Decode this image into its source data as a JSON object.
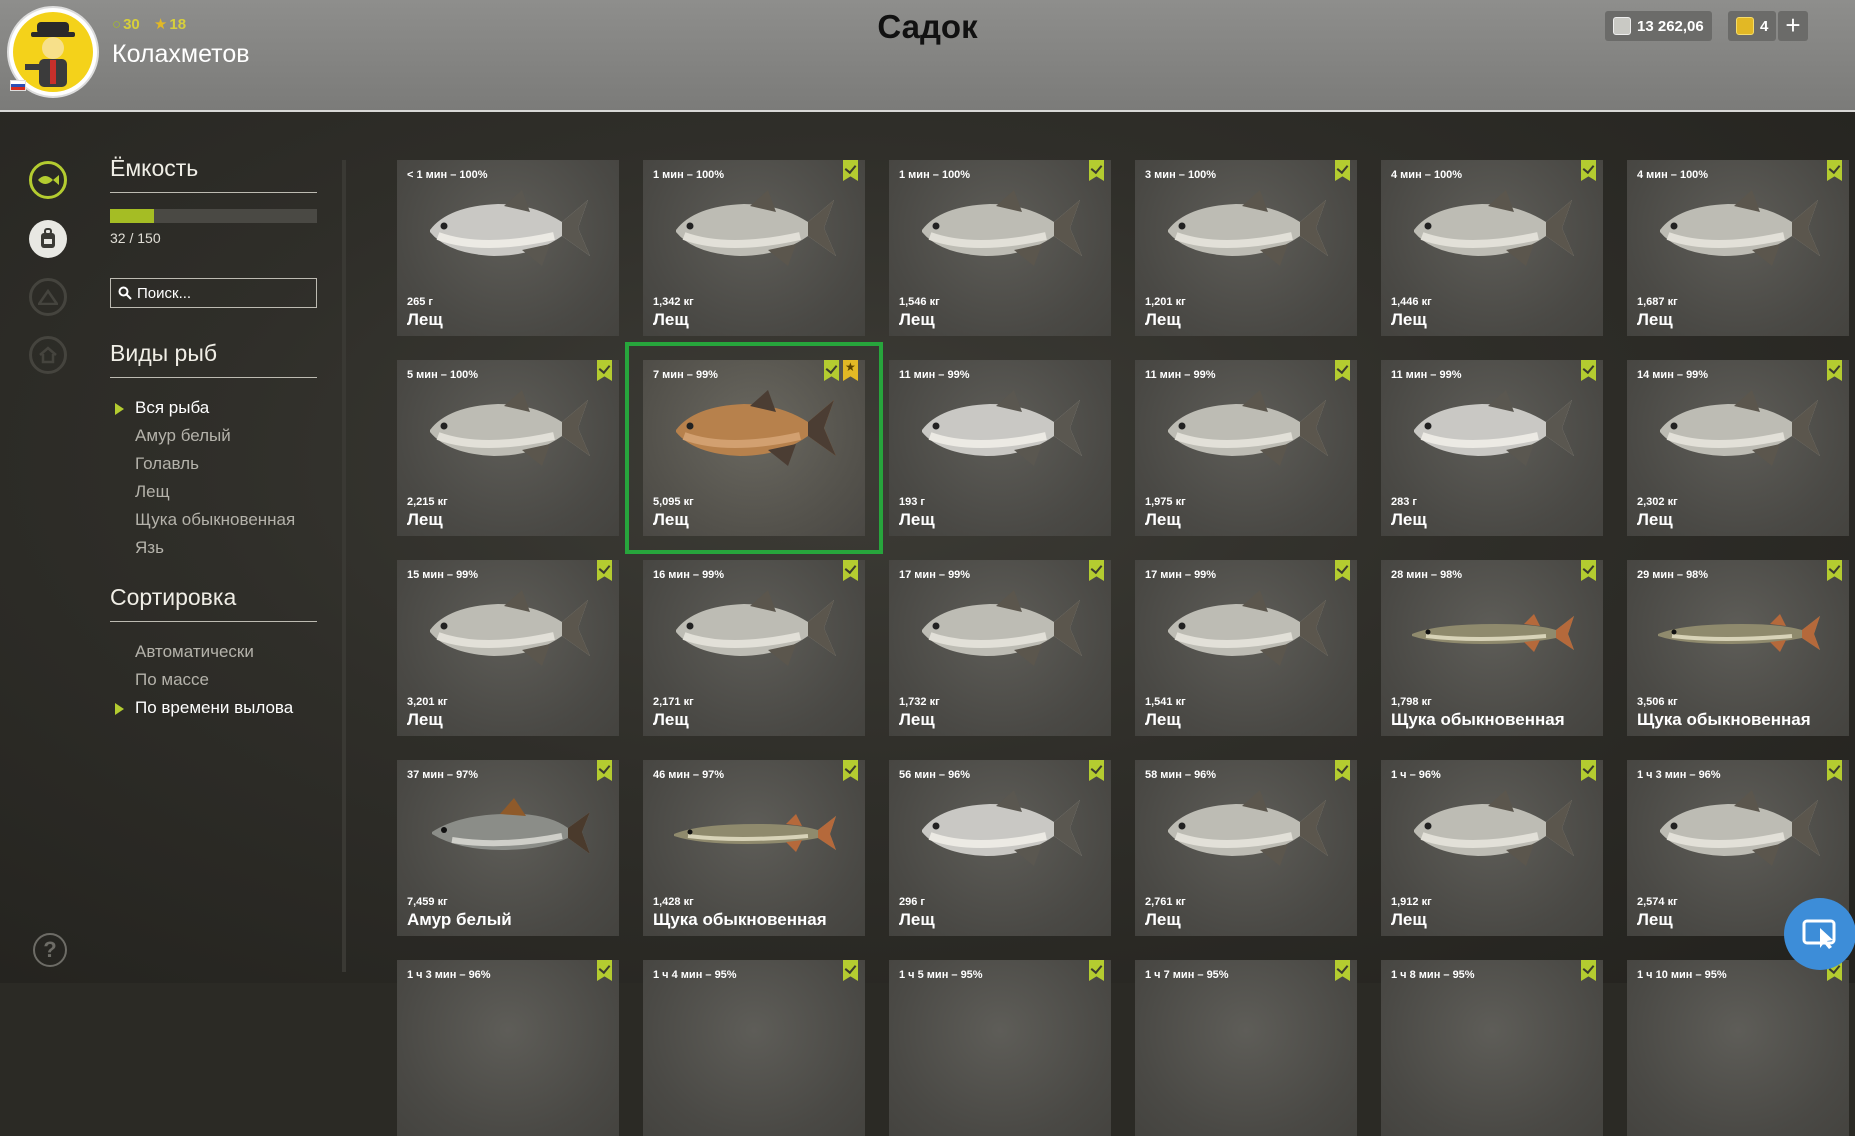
{
  "header": {
    "title": "Садок",
    "player_name": "Колахметов",
    "level": "30",
    "rank": "18",
    "silver": "13 262,06",
    "gold": "4",
    "add_label": "+"
  },
  "sidebar": {
    "capacity_title": "Ёмкость",
    "capacity_text": "32 / 150",
    "capacity_fraction": 0.213,
    "search_placeholder": "Поиск...",
    "species_title": "Виды рыб",
    "species": [
      "Вся рыба",
      "Амур белый",
      "Голавль",
      "Лещ",
      "Щука обыкновенная",
      "Язь"
    ],
    "species_active": 0,
    "sort_title": "Сортировка",
    "sort": [
      "Автоматически",
      "По массе",
      "По времени вылова"
    ],
    "sort_active": 2
  },
  "help_label": "?",
  "colors": {
    "accent": "#b4cc30",
    "selected": "#27a53c",
    "gold_badge": "#e2b825",
    "assist": "#3d8dd8"
  },
  "cards": [
    {
      "time": "< 1 мин – 100%",
      "weight": "265 г",
      "name": "Лещ",
      "kind": "bream-silver",
      "badge": ""
    },
    {
      "time": "1 мин – 100%",
      "weight": "1,342 кг",
      "name": "Лещ",
      "kind": "bream",
      "badge": "check"
    },
    {
      "time": "1 мин – 100%",
      "weight": "1,546 кг",
      "name": "Лещ",
      "kind": "bream",
      "badge": "check"
    },
    {
      "time": "3 мин – 100%",
      "weight": "1,201 кг",
      "name": "Лещ",
      "kind": "bream",
      "badge": "check"
    },
    {
      "time": "4 мин – 100%",
      "weight": "1,446 кг",
      "name": "Лещ",
      "kind": "bream",
      "badge": "check"
    },
    {
      "time": "4 мин – 100%",
      "weight": "1,687 кг",
      "name": "Лещ",
      "kind": "bream",
      "badge": "check"
    },
    {
      "time": "5 мин – 100%",
      "weight": "2,215 кг",
      "name": "Лещ",
      "kind": "bream",
      "badge": "check"
    },
    {
      "time": "7 мин – 99%",
      "weight": "5,095 кг",
      "name": "Лещ",
      "kind": "bream-gold",
      "badge": "check+gold",
      "selected": true
    },
    {
      "time": "11 мин – 99%",
      "weight": "193 г",
      "name": "Лещ",
      "kind": "bream-silver",
      "badge": ""
    },
    {
      "time": "11 мин – 99%",
      "weight": "1,975 кг",
      "name": "Лещ",
      "kind": "bream",
      "badge": "check"
    },
    {
      "time": "11 мин – 99%",
      "weight": "283 г",
      "name": "Лещ",
      "kind": "bream-silver",
      "badge": "check"
    },
    {
      "time": "14 мин – 99%",
      "weight": "2,302 кг",
      "name": "Лещ",
      "kind": "bream",
      "badge": "check"
    },
    {
      "time": "15 мин – 99%",
      "weight": "3,201 кг",
      "name": "Лещ",
      "kind": "bream",
      "badge": "check"
    },
    {
      "time": "16 мин – 99%",
      "weight": "2,171 кг",
      "name": "Лещ",
      "kind": "bream",
      "badge": "check"
    },
    {
      "time": "17 мин – 99%",
      "weight": "1,732 кг",
      "name": "Лещ",
      "kind": "bream",
      "badge": "check"
    },
    {
      "time": "17 мин – 99%",
      "weight": "1,541 кг",
      "name": "Лещ",
      "kind": "bream",
      "badge": "check"
    },
    {
      "time": "28 мин – 98%",
      "weight": "1,798 кг",
      "name": "Щука обыкновенная",
      "kind": "pike",
      "badge": "check"
    },
    {
      "time": "29 мин – 98%",
      "weight": "3,506 кг",
      "name": "Щука обыкновенная",
      "kind": "pike",
      "badge": "check"
    },
    {
      "time": "37 мин – 97%",
      "weight": "7,459 кг",
      "name": "Амур белый",
      "kind": "carp",
      "badge": "check"
    },
    {
      "time": "46 мин – 97%",
      "weight": "1,428 кг",
      "name": "Щука обыкновенная",
      "kind": "pike",
      "badge": "check"
    },
    {
      "time": "56 мин – 96%",
      "weight": "296 г",
      "name": "Лещ",
      "kind": "bream-silver",
      "badge": "check"
    },
    {
      "time": "58 мин – 96%",
      "weight": "2,761 кг",
      "name": "Лещ",
      "kind": "bream",
      "badge": "check"
    },
    {
      "time": "1 ч – 96%",
      "weight": "1,912 кг",
      "name": "Лещ",
      "kind": "bream",
      "badge": "check"
    },
    {
      "time": "1 ч 3 мин – 96%",
      "weight": "2,574 кг",
      "name": "Лещ",
      "kind": "bream",
      "badge": "check"
    },
    {
      "time": "1 ч 3 мин – 96%",
      "weight": "",
      "name": "",
      "kind": "",
      "badge": "check"
    },
    {
      "time": "1 ч 4 мин – 95%",
      "weight": "",
      "name": "",
      "kind": "",
      "badge": "check"
    },
    {
      "time": "1 ч 5 мин – 95%",
      "weight": "",
      "name": "",
      "kind": "",
      "badge": "check"
    },
    {
      "time": "1 ч 7 мин – 95%",
      "weight": "",
      "name": "",
      "kind": "",
      "badge": "check"
    },
    {
      "time": "1 ч 8 мин – 95%",
      "weight": "",
      "name": "",
      "kind": "",
      "badge": "check"
    },
    {
      "time": "1 ч 10 мин – 95%",
      "weight": "",
      "name": "",
      "kind": "",
      "badge": "check"
    }
  ]
}
